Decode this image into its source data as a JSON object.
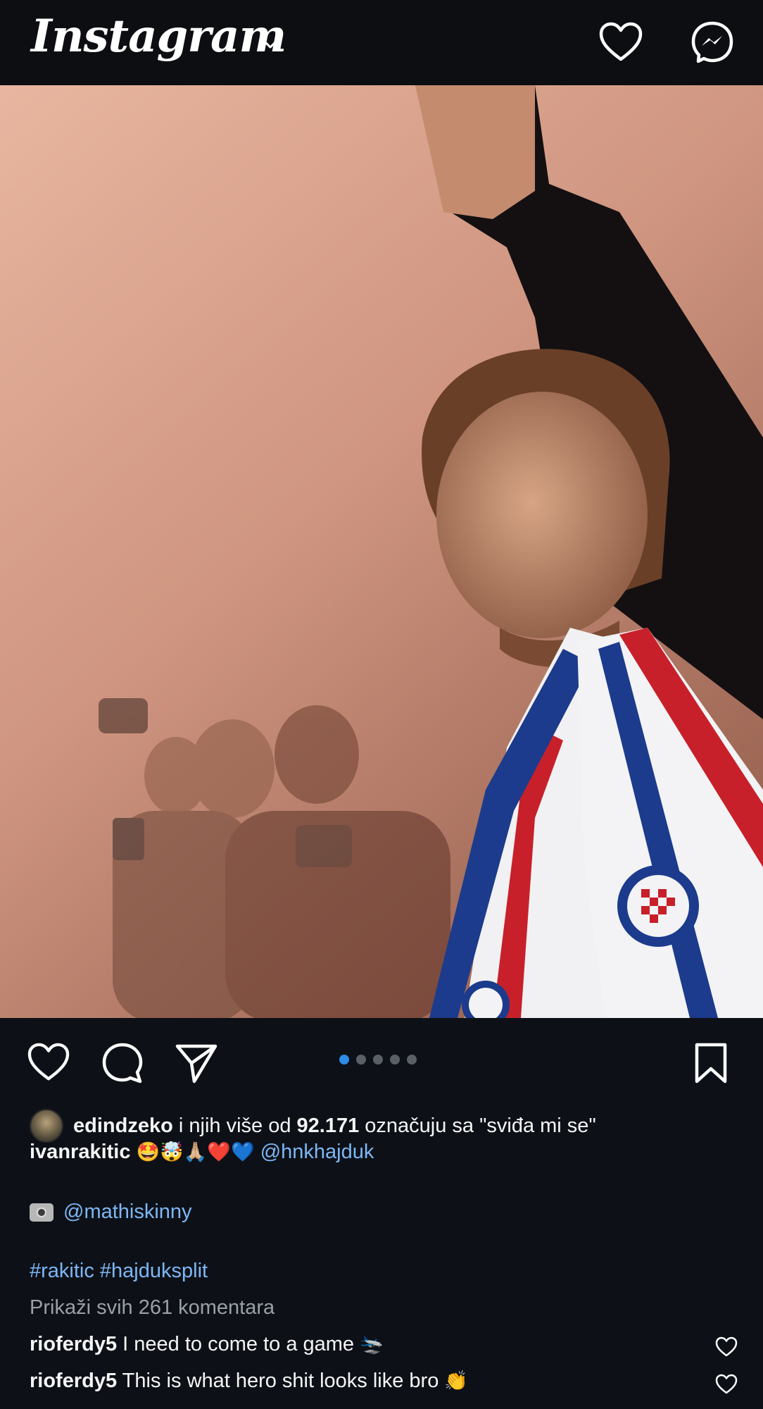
{
  "header": {
    "app_title": "Instagram"
  },
  "post": {
    "likes": {
      "user": "edindzeko",
      "middle": " i njih više od ",
      "count": "92.171",
      "suffix": " označuju sa \"sviđa mi se\""
    },
    "caption": {
      "author": "ivanrakitic",
      "emojis": "🤩🤯🙏🏼❤️💙",
      "mention": "@hnkhajduk",
      "photo_credit": "@mathiskinny",
      "hashtags": "#rakitic #hajduksplit"
    },
    "view_comments": "Prikaži svih 261 komentara",
    "comments": [
      {
        "user": "rioferdy5",
        "text": "I need to come to a game",
        "emoji": "🛬"
      },
      {
        "user": "rioferdy5",
        "text": "This is what hero shit looks like bro",
        "emoji": "👏"
      }
    ],
    "carousel": {
      "total": 5,
      "active": 1
    }
  },
  "icons": {
    "top": [
      "chevron-down-icon",
      "heart-icon",
      "messenger-icon"
    ],
    "actions": [
      "heart-icon",
      "comment-icon",
      "share-icon",
      "bookmark-icon"
    ]
  },
  "colors": {
    "background": "#0d1117",
    "link": "#7db7f5",
    "active_dot": "#2e8be6"
  }
}
